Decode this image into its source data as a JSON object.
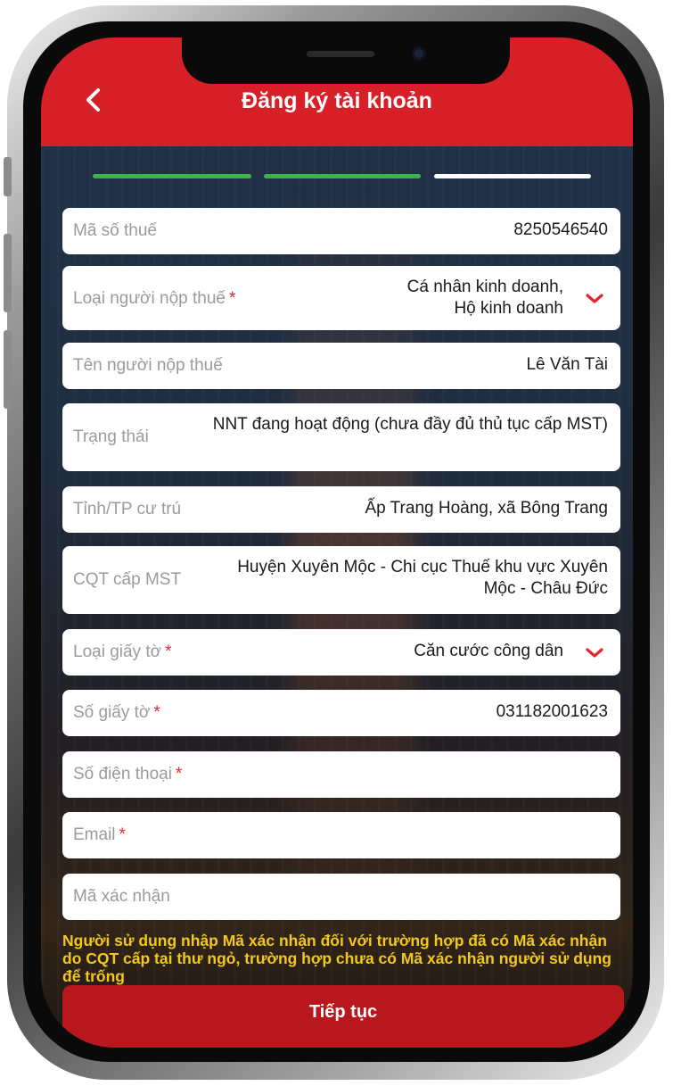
{
  "header": {
    "title": "Đăng ký tài khoản",
    "back_icon": "chevron-left-icon",
    "background": "#d61f26"
  },
  "steps": [
    {
      "state": "done",
      "color": "#3bb44a"
    },
    {
      "state": "done",
      "color": "#3bb44a"
    },
    {
      "state": "current",
      "color": "#ffffff"
    }
  ],
  "form": {
    "tax_code": {
      "label": "Mã số thuế",
      "value": "8250546540"
    },
    "taxpayer_type": {
      "label": "Loại người nộp thuế",
      "required_mark": "*",
      "value": "Cá nhân kinh doanh, Hộ kinh doanh"
    },
    "taxpayer_name": {
      "label": "Tên người nộp thuế",
      "value": "Lê Văn Tài"
    },
    "status": {
      "label": "Trạng thái",
      "value": "NNT đang hoạt động (chưa đầy đủ thủ tục cấp MST)"
    },
    "residence": {
      "label": "Tỉnh/TP cư trú",
      "value": "Ấp Trang Hoàng, xã Bông Trang"
    },
    "issuing_authority": {
      "label": "CQT cấp MST",
      "value": "Huyện Xuyên Mộc - Chi cục Thuế khu vực Xuyên Mộc - Châu Đức"
    },
    "document_type": {
      "label": "Loại giấy tờ",
      "required_mark": "*",
      "value": "Căn cước công dân"
    },
    "document_number": {
      "label": "Số giấy tờ",
      "required_mark": "*",
      "value": "031182001623"
    },
    "phone": {
      "label": "Số điện thoại",
      "required_mark": "*",
      "value": ""
    },
    "email": {
      "label": "Email",
      "required_mark": "*",
      "value": ""
    },
    "verification_code": {
      "label": "Mã xác nhận",
      "value": ""
    }
  },
  "note": "Người sử dụng nhập Mã xác nhận đối với trường hợp đã có Mã xác nhận do CQT cấp tại thư ngỏ, trường hợp chưa có Mã xác nhận người sử dụng để trống",
  "continue_button": {
    "label": "Tiếp tục",
    "color": "#b8171d"
  },
  "colors": {
    "accent": "#d61f26",
    "required": "#e3262e",
    "note_text": "#f2c81b"
  }
}
